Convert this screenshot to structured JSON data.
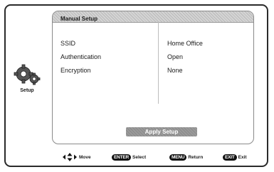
{
  "sidebar": {
    "label": "Setup",
    "icon": "gears-icon"
  },
  "panel": {
    "title": "Manual Setup",
    "rows": [
      {
        "label": "SSID",
        "value": "Home Office"
      },
      {
        "label": "Authentication",
        "value": "Open"
      },
      {
        "label": "Encryption",
        "value": "None"
      }
    ],
    "apply_label": "Apply Setup"
  },
  "hints": {
    "move": "Move",
    "enter_key": "ENTER",
    "enter_action": "Select",
    "menu_key": "MENU",
    "menu_action": "Return",
    "exit_key": "EXIT",
    "exit_action": "Exit"
  }
}
